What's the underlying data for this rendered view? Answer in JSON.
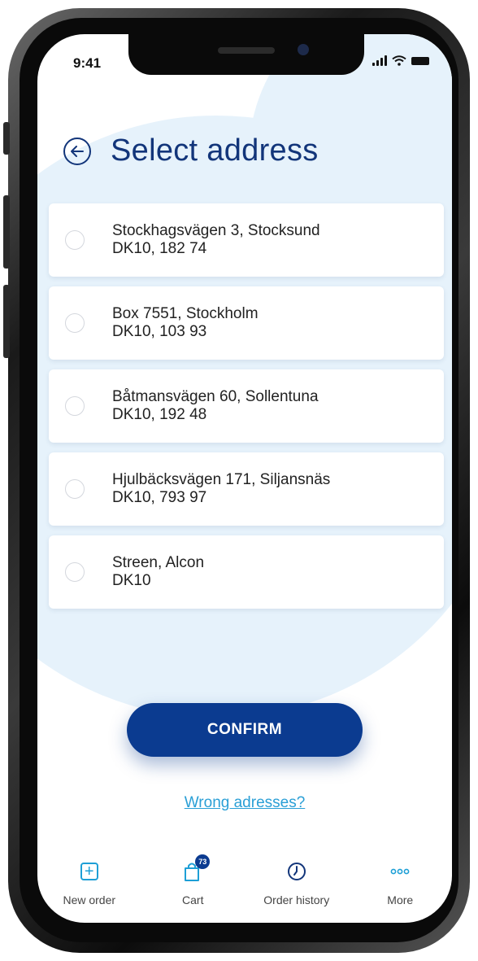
{
  "status_bar": {
    "time": "9:41"
  },
  "header": {
    "title": "Select address"
  },
  "addresses": [
    {
      "line1": "Stockhagsvägen 3, Stocksund",
      "line2": "DK10, 182 74"
    },
    {
      "line1": "Box 7551, Stockholm",
      "line2": "DK10, 103 93"
    },
    {
      "line1": "Båtmansvägen 60, Sollentuna",
      "line2": "DK10, 192 48"
    },
    {
      "line1": "Hjulbäcksvägen 171, Siljansnäs",
      "line2": "DK10, 793 97"
    },
    {
      "line1": "Streen, Alcon",
      "line2": "DK10"
    }
  ],
  "actions": {
    "confirm_label": "CONFIRM",
    "wrong_addresses_link": "Wrong adresses?"
  },
  "tab_bar": {
    "items": [
      {
        "label": "New order",
        "icon": "plus-square-icon"
      },
      {
        "label": "Cart",
        "icon": "cart-bag-icon",
        "badge": "73"
      },
      {
        "label": "Order history",
        "icon": "clock-icon"
      },
      {
        "label": "More",
        "icon": "more-dots-icon"
      }
    ]
  },
  "colors": {
    "primary": "#0b3b90",
    "title": "#12357a",
    "accent": "#1e9fd6",
    "background_shape": "#e6f2fb"
  }
}
